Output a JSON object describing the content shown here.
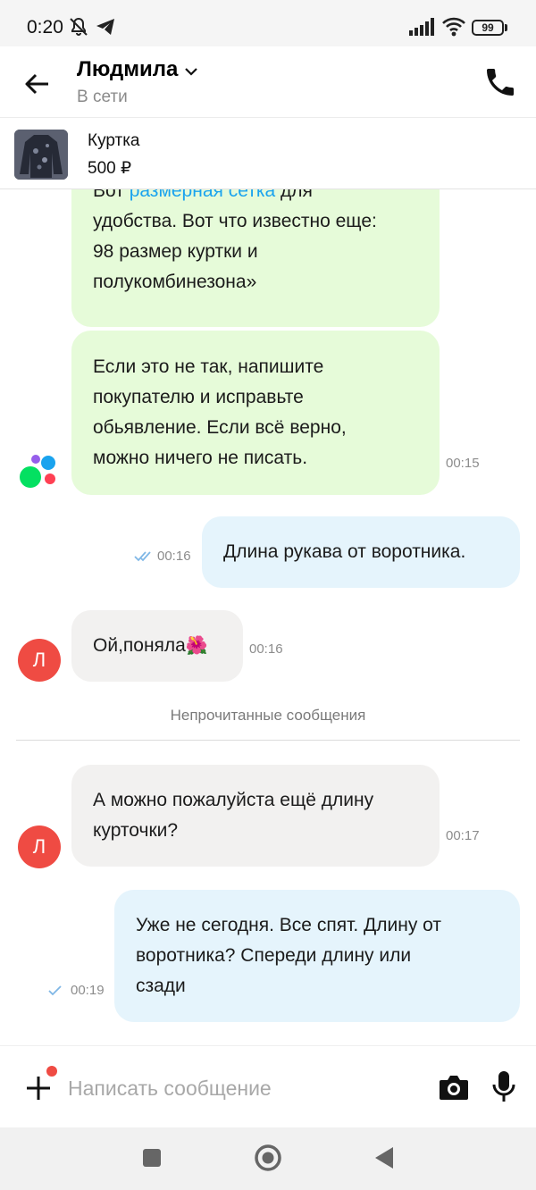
{
  "status_bar": {
    "time": "0:20",
    "battery": "99",
    "icons": [
      "mute-icon",
      "telegram-icon",
      "signal-icon",
      "wifi-icon",
      "battery-icon"
    ]
  },
  "header": {
    "contact_name": "Людмила",
    "contact_status": "В сети",
    "icons": [
      "back-arrow-icon",
      "chevron-down-icon",
      "phone-icon"
    ]
  },
  "item": {
    "title": "Куртка",
    "price": "500 ₽"
  },
  "messages": [
    {
      "from": "bot",
      "line1_pre": "Вот ",
      "line1_link": "размерная сетка",
      "line1_post": " для",
      "lines": [
        "удобства. Вот что известно еще:",
        "98 размер куртки и",
        "полукомбинезона»"
      ]
    },
    {
      "from": "bot",
      "lines": [
        "Если это не так, напишите",
        "покупателю и исправьте",
        "обьявление. Если всё верно,",
        "можно ничего не писать."
      ],
      "time": "00:15"
    },
    {
      "from": "me",
      "lines": [
        "Длина рукава от воротника."
      ],
      "time": "00:16",
      "status": "read"
    },
    {
      "from": "contact",
      "avatar": "Л",
      "text": "Ой,поняла",
      "emoji": "🌺",
      "time": "00:16"
    },
    {
      "from": "contact",
      "avatar": "Л",
      "lines": [
        "А можно пожалуйста ещё длину",
        "курточки?"
      ],
      "time": "00:17"
    },
    {
      "from": "me",
      "lines": [
        "Уже не сегодня. Все спят. Длину от",
        "воротника? Спереди длину или",
        "сзади"
      ],
      "time": "00:19",
      "status": "sent"
    }
  ],
  "divider": "Непрочитанные сообщения",
  "input": {
    "placeholder": "Написать сообщение",
    "icons": [
      "plus-icon",
      "camera-icon",
      "microphone-icon"
    ]
  },
  "nav": {
    "icons": [
      "recents-square-icon",
      "home-circle-icon",
      "back-triangle-icon"
    ]
  },
  "colors": {
    "bot_bubble": "#e6fbd9",
    "contact_bubble": "#f2f1f0",
    "own_bubble": "#e5f4fc",
    "link": "#1aa3ee",
    "avatar": "#ef4b43",
    "read_check": "#7fb7e6"
  }
}
